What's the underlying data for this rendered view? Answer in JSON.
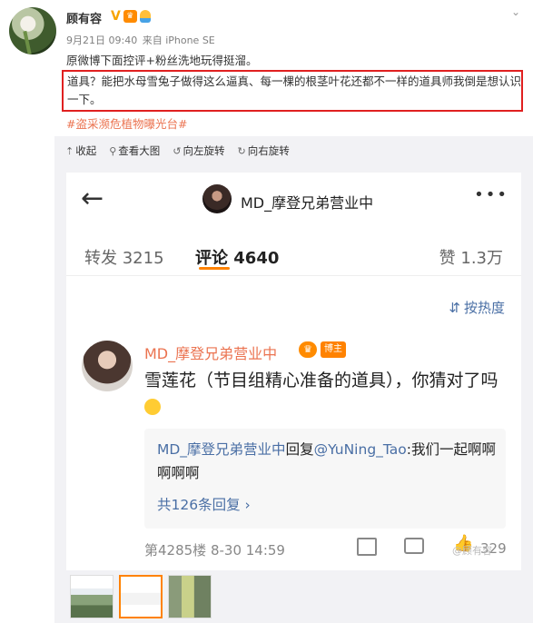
{
  "post": {
    "username": "顾有容",
    "badge_v": "V",
    "more_icon": "chevron-down-icon",
    "meta_time": "9月21日 09:40",
    "meta_source": "来自 iPhone SE",
    "line1": "原微博下面控评+粉丝洗地玩得挺溜。",
    "line2": "道具？能把水母雪兔子做得这么逼真、每一棵的根茎叶花还都不一样的道具师我倒是想认识一下。",
    "tag": "#盗采濒危植物曝光台#",
    "highlight_color": "#e02020",
    "tag_color": "#eb7350"
  },
  "toolbar": {
    "collapse": "收起",
    "view_large": "查看大图",
    "rotate_left": "向左旋转",
    "rotate_right": "向右旋转"
  },
  "screenshot": {
    "title": "MD_摩登兄弟营业中",
    "tab_repost": "转发 3215",
    "tab_comment": "评论 4640",
    "tab_like": "赞 1.3万",
    "sort_label": "按热度",
    "comment": {
      "author": "MD_摩登兄弟营业中",
      "author_badge": "博主",
      "text": "雪莲花（节目组精心准备的道具），你猜对了吗",
      "reply_author": "MD_摩登兄弟营业中",
      "reply_word": "回复",
      "reply_mention": "@YuNing_Tao",
      "reply_text": ":我们一起啊啊啊啊啊",
      "reply_count": "共126条回复 ›",
      "floor": "第4285楼 8-30 14:59",
      "like_count": "329"
    },
    "accent_color": "#ff8200",
    "link_color": "#4a6fa5"
  },
  "watermark": "@顾有容"
}
